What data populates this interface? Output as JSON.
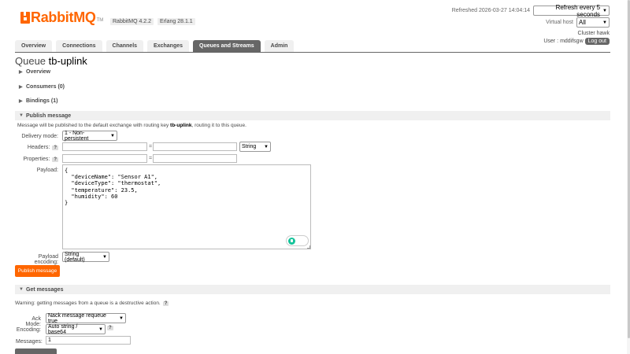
{
  "app": {
    "name": "RabbitMQ",
    "tm": "TM"
  },
  "versions": {
    "rabbitmq": "RabbitMQ 4.2.2",
    "erlang": "Erlang 28.1.1"
  },
  "header": {
    "refreshed": "Refreshed 2026-03-27 14:04:14",
    "refresh_option": "Refresh every 5 seconds",
    "vhost_label": "Virtual host",
    "vhost_value": "All",
    "cluster": "Cluster hawk",
    "user_label": "User",
    "user_name": "mddifsgw",
    "logout": "Log out"
  },
  "tabs": [
    {
      "label": "Overview"
    },
    {
      "label": "Connections"
    },
    {
      "label": "Channels"
    },
    {
      "label": "Exchanges"
    },
    {
      "label": "Queues and Streams",
      "active": true
    },
    {
      "label": "Admin"
    }
  ],
  "page": {
    "title_prefix": "Queue",
    "queue_name": "tb-uplink"
  },
  "sections": {
    "overview": "Overview",
    "consumers": "Consumers (0)",
    "bindings": "Bindings (1)",
    "publish": "Publish message",
    "get": "Get messages"
  },
  "publish": {
    "info_prefix": "Message will be published to the default exchange with routing key",
    "info_key": "tb-uplink",
    "info_suffix": ", routing it to this queue.",
    "delivery_label": "Delivery mode:",
    "delivery_value": "1 - Non-persistent",
    "headers_label": "Headers:",
    "headers_type": "String",
    "properties_label": "Properties:",
    "equals": "=",
    "help": "?",
    "payload_label": "Payload:",
    "payload": "{\n  \"deviceName\": \"Sensor A1\",\n  \"deviceType\": \"thermostat\",\n  \"temperature\": 23.5,\n  \"humidity\": 60\n}",
    "encoding_label": "Payload encoding:",
    "encoding_value": "String (default)",
    "button": "Publish message"
  },
  "get": {
    "warning": "Warning: getting messages from a queue is a destructive action.",
    "ack_label": "Ack Mode:",
    "ack_value": "Nack message requeue true",
    "encoding_label": "Encoding:",
    "encoding_value": "Auto string / base64",
    "messages_label": "Messages:",
    "messages_value": "1",
    "help": "?"
  },
  "icons": {
    "expand": "triangle-right-icon",
    "collapse": "triangle-down-icon",
    "dropdown": "chevron-down-icon"
  },
  "colors": {
    "brand": "#ff6600",
    "tab_active": "#666666"
  }
}
